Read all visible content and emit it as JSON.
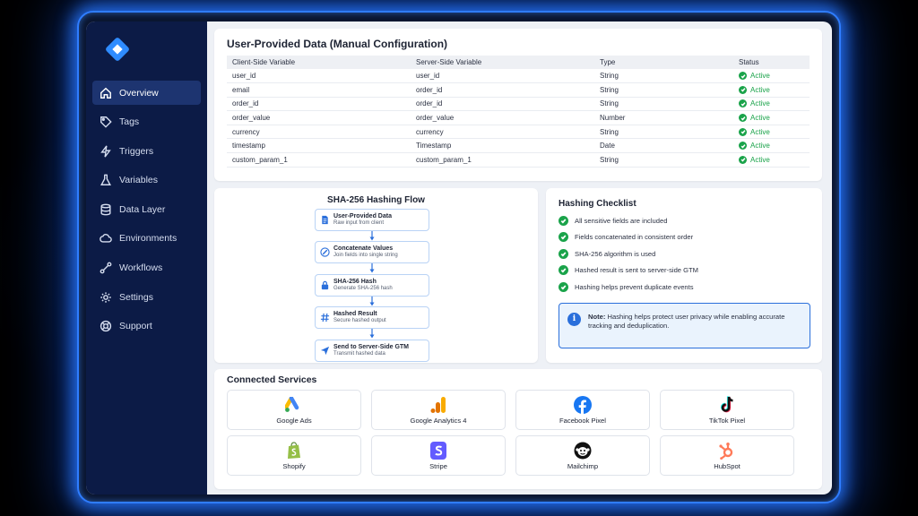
{
  "sidebar": {
    "items": [
      {
        "label": "Overview",
        "icon": "home-icon",
        "active": true
      },
      {
        "label": "Tags",
        "icon": "tag-icon"
      },
      {
        "label": "Triggers",
        "icon": "lightning-icon"
      },
      {
        "label": "Variables",
        "icon": "flask-icon"
      },
      {
        "label": "Data Layer",
        "icon": "database-icon"
      },
      {
        "label": "Environments",
        "icon": "cloud-icon"
      },
      {
        "label": "Workflows",
        "icon": "workflow-icon"
      },
      {
        "label": "Settings",
        "icon": "gear-icon"
      },
      {
        "label": "Support",
        "icon": "help-icon"
      }
    ]
  },
  "table": {
    "title": "User-Provided Data (Manual Configuration)",
    "headers": [
      "Client-Side Variable",
      "Server-Side Variable",
      "Type",
      "Status"
    ],
    "rows": [
      [
        "user_id",
        "user_id",
        "String",
        "Active"
      ],
      [
        "email",
        "order_id",
        "String",
        "Active"
      ],
      [
        "order_id",
        "order_id",
        "String",
        "Active"
      ],
      [
        "order_value",
        "order_value",
        "Number",
        "Active"
      ],
      [
        "currency",
        "currency",
        "String",
        "Active"
      ],
      [
        "timestamp",
        "Timestamp",
        "Date",
        "Active"
      ],
      [
        "custom_param_1",
        "custom_param_1",
        "String",
        "Active"
      ]
    ],
    "status_color": "#1aa34a"
  },
  "flow": {
    "title": "SHA-256 Hashing Flow",
    "steps": [
      {
        "title": "User-Provided Data",
        "sub": "Raw input from client",
        "icon": "document-icon"
      },
      {
        "title": "Concatenate Values",
        "sub": "Join fields into single string",
        "icon": "link-icon"
      },
      {
        "title": "SHA-256 Hash",
        "sub": "Generate SHA-256 hash",
        "icon": "lock-icon"
      },
      {
        "title": "Hashed Result",
        "sub": "Secure hashed output",
        "icon": "hash-icon"
      },
      {
        "title": "Send to Server-Side GTM",
        "sub": "Transmit hashed data",
        "icon": "send-icon"
      }
    ]
  },
  "checklist": {
    "title": "Hashing Checklist",
    "items": [
      "All sensitive fields are included",
      "Fields concatenated in consistent order",
      "SHA-256 algorithm is used",
      "Hashed result is sent to server-side GTM",
      "Hashing helps prevent duplicate events"
    ],
    "note_label": "Note:",
    "note_text": " Hashing helps protect user privacy while enabling accurate tracking and deduplication."
  },
  "services": {
    "title": "Connected Services",
    "items": [
      {
        "name": "Google Ads",
        "icon": "google-ads-icon"
      },
      {
        "name": "Google Analytics 4",
        "icon": "google-analytics-icon"
      },
      {
        "name": "Facebook Pixel",
        "icon": "facebook-icon"
      },
      {
        "name": "TikTok Pixel",
        "icon": "tiktok-icon"
      },
      {
        "name": "Shopify",
        "icon": "shopify-icon"
      },
      {
        "name": "Stripe",
        "icon": "stripe-icon"
      },
      {
        "name": "Mailchimp",
        "icon": "mailchimp-icon"
      },
      {
        "name": "HubSpot",
        "icon": "hubspot-icon"
      }
    ]
  },
  "colors": {
    "accent": "#2a6fdb",
    "sidebar": "#0c1b46",
    "glow": "#2f7dff",
    "active": "#1aa34a"
  }
}
